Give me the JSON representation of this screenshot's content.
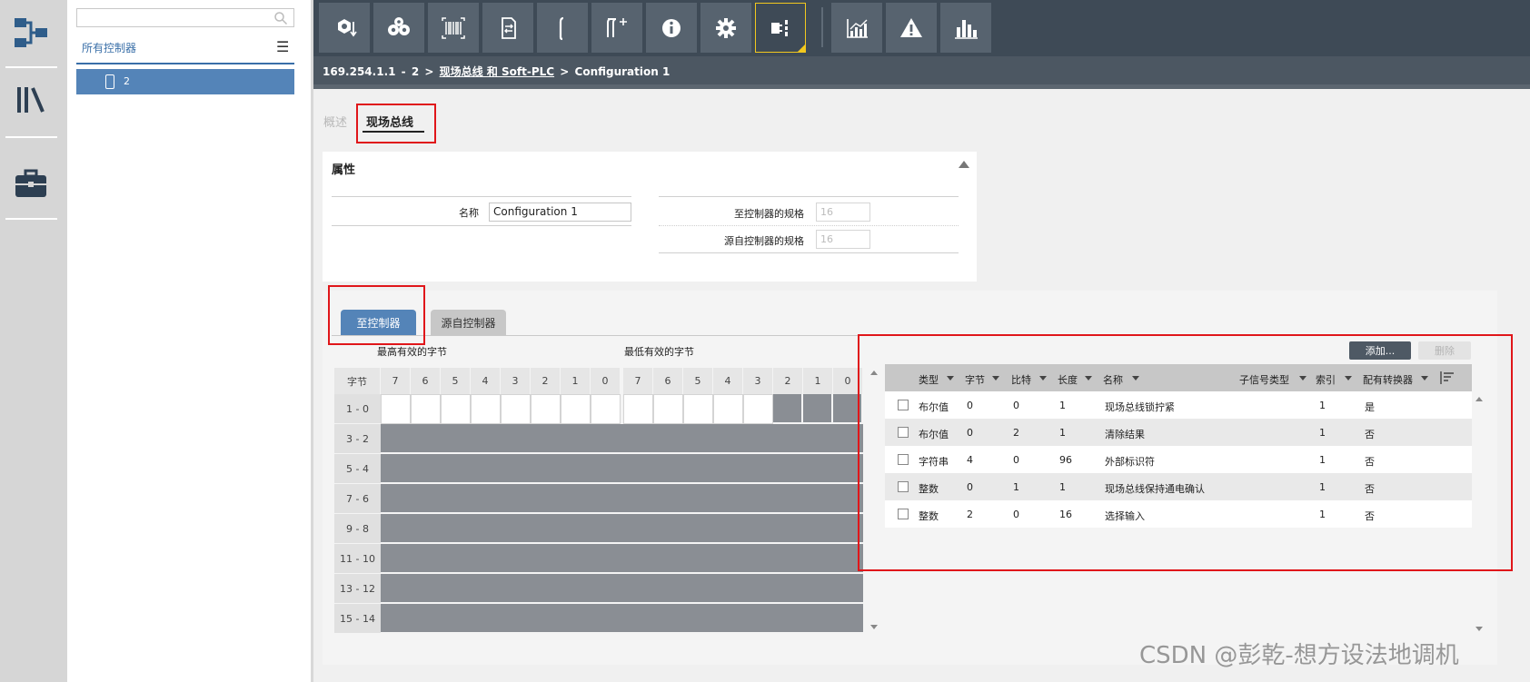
{
  "rail": {
    "items": [
      {
        "name": "network-icon"
      },
      {
        "name": "library-icon"
      },
      {
        "name": "toolbox-icon"
      }
    ]
  },
  "tree": {
    "search_placeholder": "",
    "title": "所有控制器",
    "menu_glyph": "☰",
    "selected_item": "2"
  },
  "toolbar": {
    "buttons": [
      {
        "name": "tighten-icon"
      },
      {
        "name": "settings-group-icon"
      },
      {
        "name": "barcode-icon"
      },
      {
        "name": "memory-card-icon"
      },
      {
        "name": "single-tool-icon"
      },
      {
        "name": "multi-tool-add-icon"
      },
      {
        "name": "info-icon"
      },
      {
        "name": "gear-icon"
      },
      {
        "name": "fieldbus-config-icon",
        "active": true
      },
      {
        "name": "statistics-chart-icon"
      },
      {
        "name": "warning-icon"
      },
      {
        "name": "bar-chart-icon"
      }
    ],
    "active_color": "#f2c81e"
  },
  "breadcrumb": {
    "ip": "169.254.1.1",
    "sep1": "-",
    "node": "2",
    "arrow1": ">",
    "link": "现场总线 和 Soft-PLC",
    "arrow2": ">",
    "current": "Configuration 1"
  },
  "view_tabs": {
    "overview": "概述",
    "fieldbus": "现场总线"
  },
  "properties": {
    "title": "属性",
    "name_label": "名称",
    "name_value": "Configuration 1",
    "to_controller_label": "至控制器的规格",
    "to_controller_value": "16",
    "from_controller_label": "源自控制器的规格",
    "from_controller_value": "16"
  },
  "io_tabs": {
    "to_controller": "至控制器",
    "from_controller": "源自控制器"
  },
  "byte_grid": {
    "msb_label": "最高有效的字节",
    "lsb_label": "最低有效的字节",
    "corner": "字节",
    "columns_msb": [
      "7",
      "6",
      "5",
      "4",
      "3",
      "2",
      "1",
      "0"
    ],
    "columns_lsb": [
      "7",
      "6",
      "5",
      "4",
      "3",
      "2",
      "1",
      "0"
    ],
    "rows": [
      "1 - 0",
      "3 - 2",
      "5 - 4",
      "7 - 6",
      "9 - 8",
      "11 - 10",
      "13 - 12",
      "15 - 14"
    ]
  },
  "signal_table": {
    "add_button": "添加...",
    "delete_button": "删除",
    "headers": {
      "type": "类型",
      "byte": "字节",
      "bit": "比特",
      "length": "长度",
      "name": "名称",
      "subtype": "子信号类型",
      "index": "索引",
      "converter": "配有转换器"
    },
    "rows": [
      {
        "type": "布尔值",
        "byte": "0",
        "bit": "0",
        "length": "1",
        "name": "现场总线锁拧紧",
        "index": "1",
        "converter": "是"
      },
      {
        "type": "布尔值",
        "byte": "0",
        "bit": "2",
        "length": "1",
        "name": "清除结果",
        "index": "1",
        "converter": "否"
      },
      {
        "type": "字符串",
        "byte": "4",
        "bit": "0",
        "length": "96",
        "name": "外部标识符",
        "index": "1",
        "converter": "否"
      },
      {
        "type": "整数",
        "byte": "0",
        "bit": "1",
        "length": "1",
        "name": "现场总线保持通电确认",
        "index": "1",
        "converter": "否"
      },
      {
        "type": "整数",
        "byte": "2",
        "bit": "0",
        "length": "16",
        "name": "选择输入",
        "index": "1",
        "converter": "否"
      }
    ]
  },
  "watermark": "CSDN @彭乾-想方设法地调机",
  "colors": {
    "accent_blue": "#5484b8",
    "toolbar_bg": "#3e4a56",
    "annotation_red": "#e0161a",
    "grid_fill": "#8a8e94"
  }
}
